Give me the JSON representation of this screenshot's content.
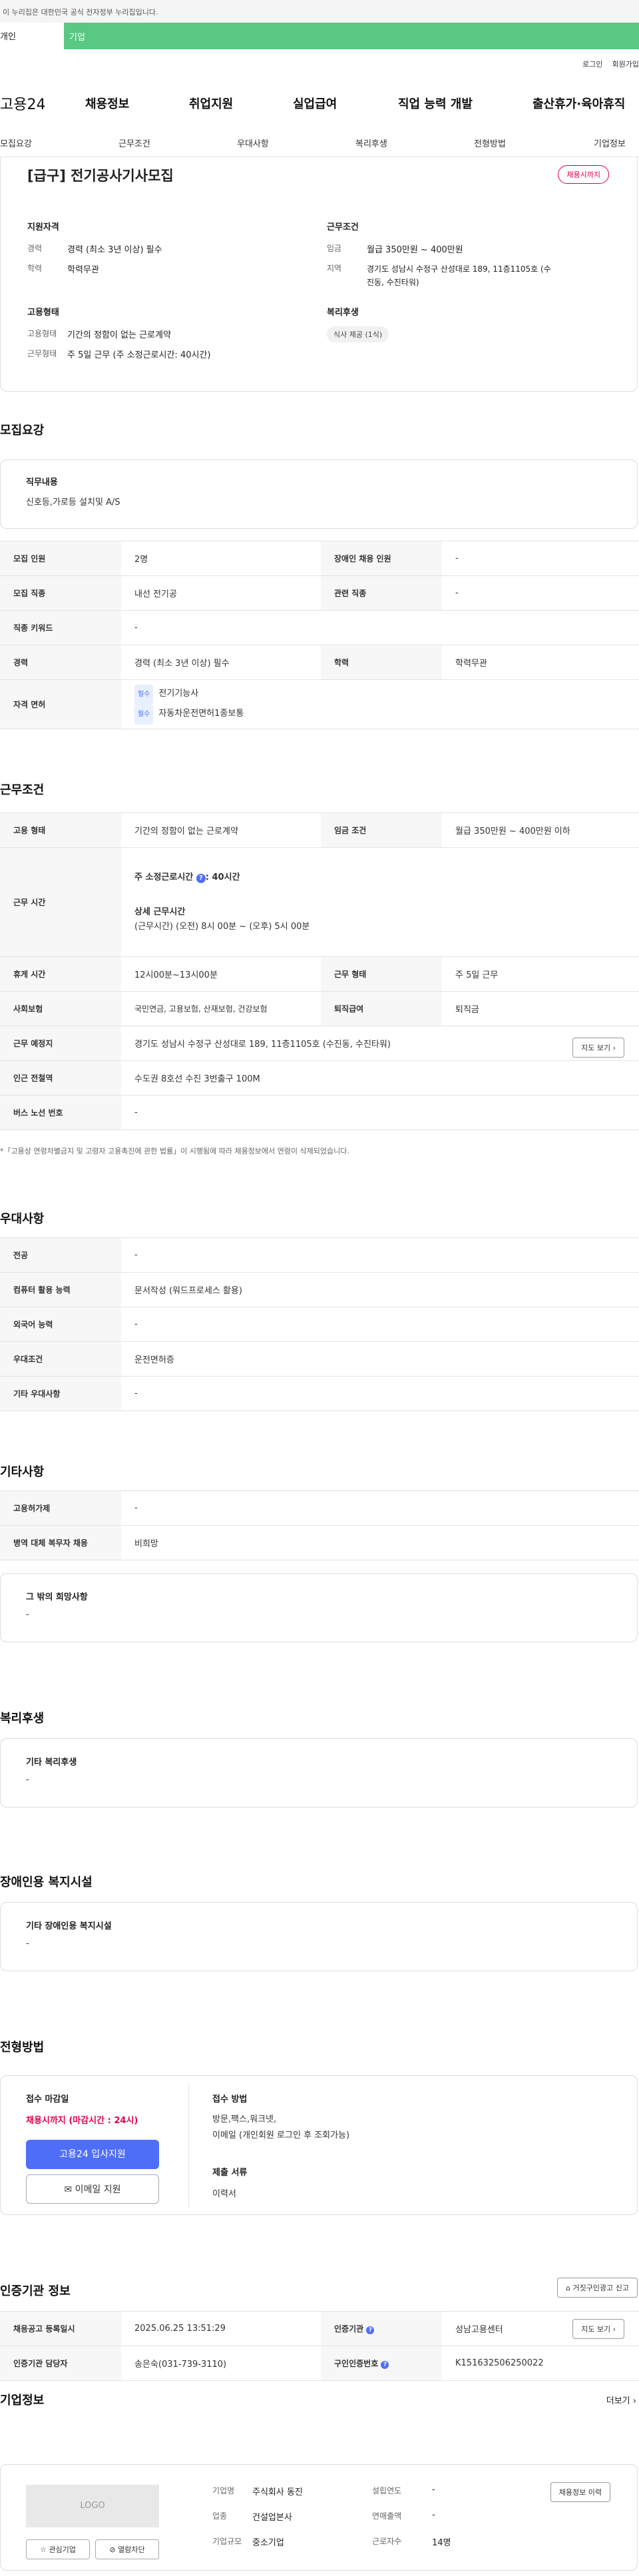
{
  "notice": "이 누리집은 대한민국 공식 전자정부 누리집입니다.",
  "tabs": [
    "개인",
    "기업"
  ],
  "top_links": [
    "로그인",
    "회원가입"
  ],
  "gnb": {
    "logo": "고용24",
    "items": [
      "채용정보",
      "취업지원",
      "실업급여",
      "직업 능력 개발",
      "출산휴가·육아휴직"
    ]
  },
  "subnav": [
    "모집요강",
    "근무조건",
    "우대사항",
    "복리후생",
    "전형방법",
    "기업정보"
  ],
  "summary": {
    "title": "[급구] 전기공사기사모집",
    "badge": "채용시까지",
    "qual_title": "지원자격",
    "career_k": "경력",
    "career_v": "경력 (최소 3년 이상) 필수",
    "edu_k": "학력",
    "edu_v": "학력무관",
    "emp_title": "고용형태",
    "emptype_k": "고용형태",
    "emptype_v": "기간의 정함이 없는 근로계약",
    "worktype_k": "근무형태",
    "worktype_v": "주 5일 근무 (주 소정근로시간: 40시간)",
    "cond_title": "근무조건",
    "wage_k": "임금",
    "wage_v": "월급 350만원 ~ 400만원",
    "region_k": "지역",
    "region_v1": "경기도 성남시 수정구 산성대로 189, 11층1105호 (수",
    "region_v2": "진동, 수진타워)",
    "welfare_title": "복리후생",
    "welfare_chip": "식사 제공 (1식)"
  },
  "recruit": {
    "heading": "모집요강",
    "duty_title": "직무내용",
    "duty_value": "신호등,가로등 설치및 A/S",
    "rows": {
      "count_k": "모집 인원",
      "count_v": "2명",
      "disab_k": "장애인 채용 인원",
      "disab_v": "-",
      "job_k": "모집 직종",
      "job_v": "내선 전기공",
      "rel_k": "관련 직종",
      "rel_v": "-",
      "kw_k": "직종 키워드",
      "kw_v": "-",
      "career_k": "경력",
      "career_v": "경력 (최소 3년 이상) 필수",
      "edu_k": "학력",
      "edu_v": "학력무관",
      "lic_k": "자격 면허",
      "lic_req": "필수",
      "lic1": "전기기능사",
      "lic2": "자동차운전면허1종보통"
    }
  },
  "work": {
    "heading": "근무조건",
    "emp_k": "고용 형태",
    "emp_v": "기간의 정함이 없는 근로계약",
    "wage_k": "임금 조건",
    "wage_v": "월급 350만원 ~ 400만원 이하",
    "time_k": "근무 시간",
    "time_main": "주 소정근로시간",
    "time_hours": "40시간",
    "time_detail_t": "상세 근무시간",
    "time_detail_v": "(근무시간) (오전) 8시 00분 ~ (오후) 5시 00분",
    "rest_k": "휴게 시간",
    "rest_v": "12시00분~13시00분",
    "form_k": "근무 형태",
    "form_v": "주 5일 근무",
    "ins_k": "사회보험",
    "ins_v": "국민연금, 고용보험, 산재보험, 건강보험",
    "sev_k": "퇴직급여",
    "sev_v": "퇴직금",
    "place_k": "근무 예정지",
    "place_v": "경기도 성남시 수정구 산성대로 189, 11층1105호 (수진동, 수진타워)",
    "map_btn": "지도 보기",
    "subway_k": "인근 전철역",
    "subway_v": "수도권 8호선 수진 3번출구 100M",
    "bus_k": "버스 노선 번호",
    "bus_v": "-",
    "footnote": "*「고용상 연령차별금지 및 고령자 고용촉진에 관한 법률」이 시행됨에 따라 채용정보에서 연령이 삭제되었습니다."
  },
  "pref": {
    "heading": "우대사항",
    "major_k": "전공",
    "major_v": "-",
    "pc_k": "컴퓨터 활용 능력",
    "pc_v": "문서작성 (워드프로세스 활용)",
    "lang_k": "외국어 능력",
    "lang_v": "-",
    "cond_k": "우대조건",
    "cond_v": "운전면허증",
    "etc_k": "기타 우대사항",
    "etc_v": "-"
  },
  "other": {
    "heading": "기타사항",
    "visa_k": "고용허가제",
    "visa_v": "-",
    "army_k": "병역 대체 복무자 채용",
    "army_v": "비희망",
    "wish_title": "그 밖의 희망사항",
    "wish_v": "-"
  },
  "welfare": {
    "heading": "복리후생",
    "title": "기타 복리후생",
    "value": "-"
  },
  "disab": {
    "heading": "장애인용 복지시설",
    "title": "기타 장애인용 복지시설",
    "value": "-"
  },
  "process": {
    "heading": "전형방법",
    "deadline_t": "접수 마감일",
    "deadline_v": "채용시까지 (마감시간 : 24시)",
    "apply_btn": "고용24 입사지원",
    "email_btn": "이메일 지원",
    "method_t": "접수 방법",
    "method_v1": "방문,팩스,워크넷,",
    "method_v2": "이메일 (개인회원 로그인 후 조회가능)",
    "docs_t": "제출 서류",
    "docs_v": "이력서"
  },
  "agency": {
    "heading": "인증기관 정보",
    "report_btn": "거짓구인광고 신고",
    "reg_k": "채용공고 등록일시",
    "reg_v": "2025.06.25 13:51:29",
    "org_k": "인증기관",
    "org_v": "성남고용센터",
    "map_btn": "지도 보기",
    "mgr_k": "인증기관 담당자",
    "mgr_v": "송은숙(031-739-3110)",
    "num_k": "구인인증번호",
    "num_v": "K151632506250022"
  },
  "company": {
    "heading": "기업정보",
    "more": "더보기",
    "logo": "LOGO",
    "fav": "관심기업",
    "block": "열람차단",
    "name_k": "기업명",
    "name_v": "주식회사 동진",
    "year_k": "설립연도",
    "year_v": "-",
    "ind_k": "업종",
    "ind_v": "건설업본사",
    "sales_k": "연매출액",
    "sales_v": "-",
    "size_k": "기업규모",
    "size_v": "중소기업",
    "emp_k": "근로자수",
    "emp_v": "14명",
    "history_btn": "채용정보 이력"
  },
  "colors": {
    "green": "#59c883",
    "accent": "#4f6ef7",
    "red": "#e0004d"
  }
}
